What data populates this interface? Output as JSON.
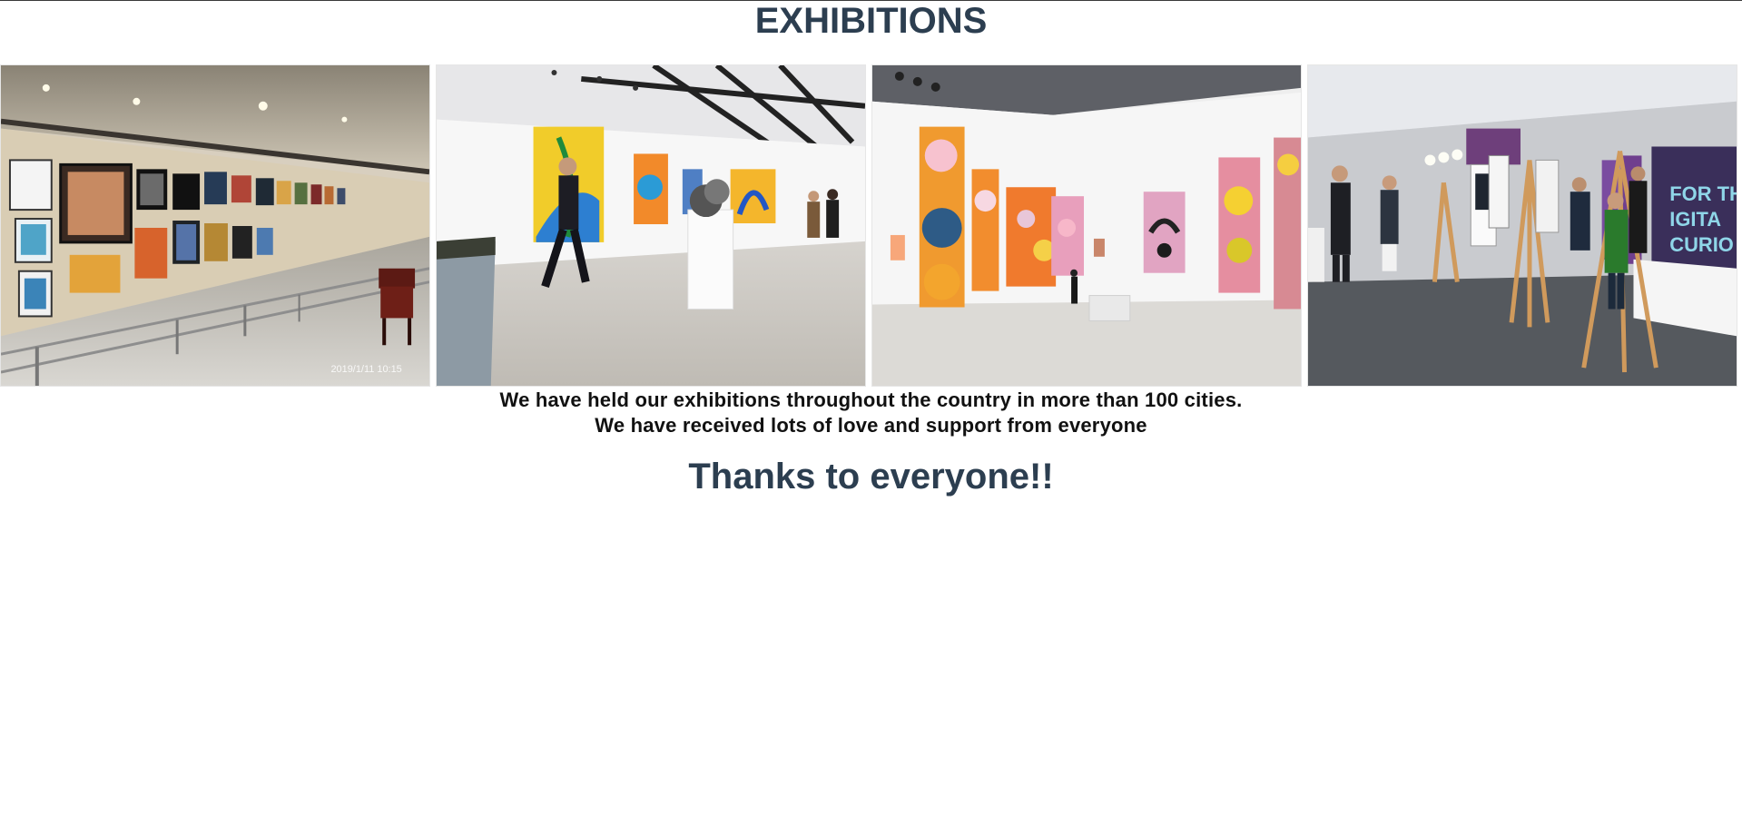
{
  "header": {
    "title": "EXHIBITIONS"
  },
  "gallery": {
    "photos": [
      {
        "alt": "Gallery hall with framed paintings along a long wall",
        "timestamp": "2019/1/11  10:15"
      },
      {
        "alt": "White gallery with colorful abstract paintings and a visitor walking"
      },
      {
        "alt": "Large bright gallery room with tall colorful canvases"
      },
      {
        "alt": "Exhibition floor with easels, visitors and banner stands"
      }
    ]
  },
  "caption": {
    "line1": "We have held our exhibitions throughout the country in more than 100 cities.",
    "line2": "We have received lots of love and support from everyone"
  },
  "thanks": {
    "text": "Thanks to everyone!!"
  },
  "colors": {
    "heading": "#2c3e50",
    "body_text": "#111111",
    "background": "#ffffff"
  }
}
